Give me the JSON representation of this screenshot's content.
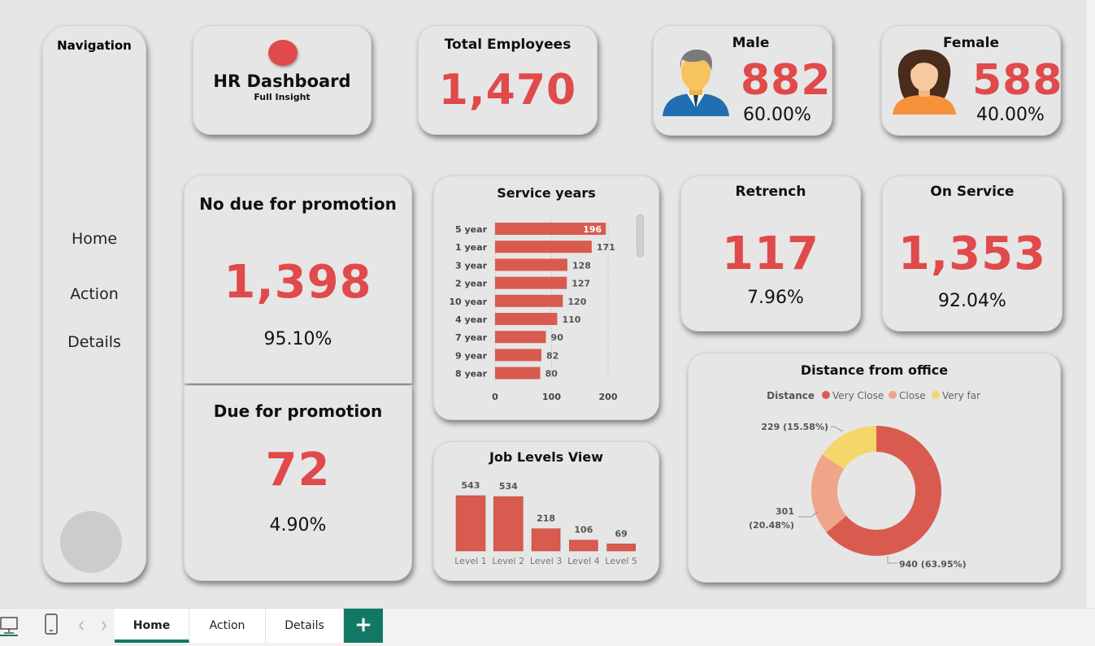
{
  "navigation": {
    "title": "Navigation",
    "links": [
      "Home",
      "Action",
      "Details"
    ]
  },
  "brand": {
    "title": "HR Dashboard",
    "subtitle": "Full Insight"
  },
  "kpis": {
    "total_employees": {
      "title": "Total Employees",
      "value": "1,470"
    },
    "male": {
      "title": "Male",
      "value": "882",
      "percent": "60.00%"
    },
    "female": {
      "title": "Female",
      "value": "588",
      "percent": "40.00%"
    },
    "no_due_promotion": {
      "title": "No due for promotion",
      "value": "1,398",
      "percent": "95.10%"
    },
    "due_promotion": {
      "title": "Due for promotion",
      "value": "72",
      "percent": "4.90%"
    },
    "retrench": {
      "title": "Retrench",
      "value": "117",
      "percent": "7.96%"
    },
    "on_service": {
      "title": "On Service",
      "value": "1,353",
      "percent": "92.04%"
    }
  },
  "colors": {
    "accent": "#e04a4a",
    "bar": "#d95b4f",
    "very_close": "#d95b4f",
    "close": "#f0a58a",
    "very_far": "#f5d66a",
    "tab_accent": "#117865"
  },
  "chart_data": [
    {
      "type": "bar",
      "orientation": "horizontal",
      "title": "Service years",
      "categories": [
        "5 year",
        "1 year",
        "3 year",
        "2 year",
        "10 year",
        "4 year",
        "7 year",
        "9 year",
        "8 year"
      ],
      "values": [
        196,
        171,
        128,
        127,
        120,
        110,
        90,
        82,
        80
      ],
      "xticks": [
        "0",
        "100",
        "200"
      ],
      "xlim": [
        0,
        200
      ],
      "grid": true
    },
    {
      "type": "bar",
      "title": "Job Levels View",
      "categories": [
        "Level 1",
        "Level 2",
        "Level 3",
        "Level 4",
        "Level 5"
      ],
      "values": [
        543,
        534,
        218,
        106,
        69
      ]
    },
    {
      "type": "pie",
      "donut": true,
      "title": "Distance from office",
      "legend_title": "Distance",
      "legend_position": "top",
      "series": [
        {
          "name": "Very Close",
          "value": 940,
          "label": "940 (63.95%)"
        },
        {
          "name": "Close",
          "value": 301,
          "label": "301 (20.48%)"
        },
        {
          "name": "Very far",
          "value": 229,
          "label": "229 (15.58%)"
        }
      ]
    }
  ],
  "tabs": [
    "Home",
    "Action",
    "Details"
  ],
  "add_tab_label": "+",
  "device_icons": [
    "desktop-icon",
    "mobile-icon"
  ]
}
